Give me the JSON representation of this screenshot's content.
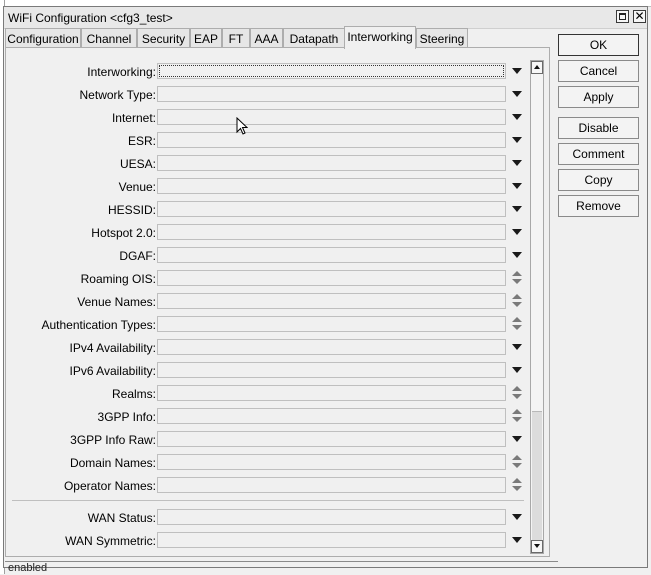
{
  "window": {
    "title": "WiFi Configuration <cfg3_test>",
    "close_glyph": "✕"
  },
  "tabs": [
    {
      "label": "Configuration"
    },
    {
      "label": "Channel"
    },
    {
      "label": "Security"
    },
    {
      "label": "EAP"
    },
    {
      "label": "FT"
    },
    {
      "label": "AAA"
    },
    {
      "label": "Datapath"
    },
    {
      "label": "Interworking"
    },
    {
      "label": "Steering"
    }
  ],
  "active_tab": "Interworking",
  "fields": [
    {
      "label": "Interworking:",
      "value": "",
      "control": "dropdown"
    },
    {
      "label": "Network Type:",
      "value": "",
      "control": "dropdown"
    },
    {
      "label": "Internet:",
      "value": "",
      "control": "dropdown"
    },
    {
      "label": "ESR:",
      "value": "",
      "control": "dropdown"
    },
    {
      "label": "UESA:",
      "value": "",
      "control": "dropdown"
    },
    {
      "label": "Venue:",
      "value": "",
      "control": "dropdown"
    },
    {
      "label": "HESSID:",
      "value": "",
      "control": "dropdown"
    },
    {
      "label": "Hotspot 2.0:",
      "value": "",
      "control": "dropdown"
    },
    {
      "label": "DGAF:",
      "value": "",
      "control": "dropdown"
    },
    {
      "label": "Roaming OIS:",
      "value": "",
      "control": "spinner"
    },
    {
      "label": "Venue Names:",
      "value": "",
      "control": "spinner"
    },
    {
      "label": "Authentication Types:",
      "value": "",
      "control": "spinner"
    },
    {
      "label": "IPv4 Availability:",
      "value": "",
      "control": "dropdown"
    },
    {
      "label": "IPv6 Availability:",
      "value": "",
      "control": "dropdown"
    },
    {
      "label": "Realms:",
      "value": "",
      "control": "spinner"
    },
    {
      "label": "3GPP Info:",
      "value": "",
      "control": "spinner"
    },
    {
      "label": "3GPP Info Raw:",
      "value": "",
      "control": "dropdown"
    },
    {
      "label": "Domain Names:",
      "value": "",
      "control": "spinner"
    },
    {
      "label": "Operator Names:",
      "value": "",
      "control": "spinner"
    },
    {
      "label": "WAN Status:",
      "value": "",
      "control": "dropdown"
    },
    {
      "label": "WAN Symmetric:",
      "value": "",
      "control": "dropdown"
    }
  ],
  "buttons": {
    "ok": "OK",
    "cancel": "Cancel",
    "apply": "Apply",
    "disable": "Disable",
    "comment": "Comment",
    "copy": "Copy",
    "remove": "Remove"
  },
  "status": {
    "text": "enabled"
  },
  "icons": {
    "restore": "restore-icon",
    "close": "close-icon",
    "dropdown": "dropdown-arrow-icon",
    "spinner": "up-down-spinner-icon",
    "cursor": "mouse-pointer-icon"
  }
}
